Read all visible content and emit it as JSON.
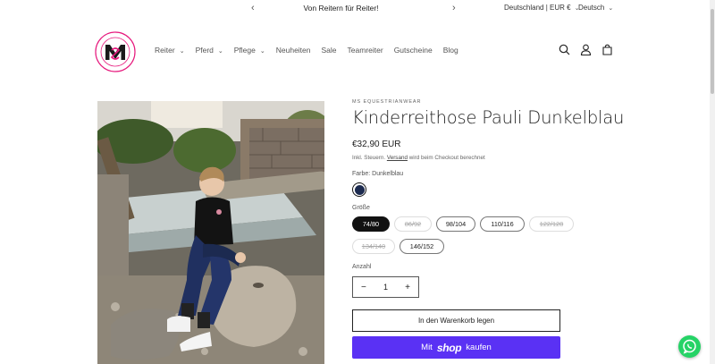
{
  "announcement": {
    "message": "Von Reitern für Reiter!",
    "prev_icon": "chevron-left-icon",
    "next_icon": "chevron-right-icon"
  },
  "locale": {
    "country": "Deutschland | EUR €",
    "language": "Deutsch"
  },
  "logo": {
    "text_top": "EQUESTRIAN WEAR",
    "text_bottom": "COMFORT | STYLE",
    "monogram": "MS"
  },
  "nav": [
    {
      "label": "Reiter",
      "dropdown": true
    },
    {
      "label": "Pferd",
      "dropdown": true
    },
    {
      "label": "Pflege",
      "dropdown": true
    },
    {
      "label": "Neuheiten",
      "dropdown": false
    },
    {
      "label": "Sale",
      "dropdown": false
    },
    {
      "label": "Teamreiter",
      "dropdown": false
    },
    {
      "label": "Gutscheine",
      "dropdown": false
    },
    {
      "label": "Blog",
      "dropdown": false
    }
  ],
  "header_icons": [
    "search-icon",
    "account-icon",
    "cart-icon"
  ],
  "product": {
    "vendor": "MS EQUESTRIANWEAR",
    "title": "Kinderreithose Pauli Dunkelblau",
    "price": "€32,90 EUR",
    "tax_prefix": "Inkl. Steuern.",
    "tax_link": "Versand",
    "tax_suffix": "wird beim Checkout berechnet",
    "color_label": "Farbe: Dunkelblau",
    "color_value": "#1c2a4f",
    "size_label": "Größe",
    "sizes": [
      {
        "label": "74/80",
        "state": "selected"
      },
      {
        "label": "86/92",
        "state": "unavailable"
      },
      {
        "label": "98/104",
        "state": "available"
      },
      {
        "label": "110/116",
        "state": "available"
      },
      {
        "label": "122/128",
        "state": "unavailable"
      },
      {
        "label": "134/140",
        "state": "unavailable"
      },
      {
        "label": "146/152",
        "state": "available"
      }
    ],
    "qty_label": "Anzahl",
    "qty_value": "1",
    "qty_minus": "−",
    "qty_plus": "+",
    "add_to_cart": "In den Warenkorb legen",
    "shop_pay_prefix": "Mit",
    "shop_pay_brand": "shop",
    "shop_pay_suffix": "kaufen"
  },
  "colors": {
    "accent": "#5a31f4",
    "logo_pink": "#e6197d",
    "whatsapp": "#25d366"
  }
}
